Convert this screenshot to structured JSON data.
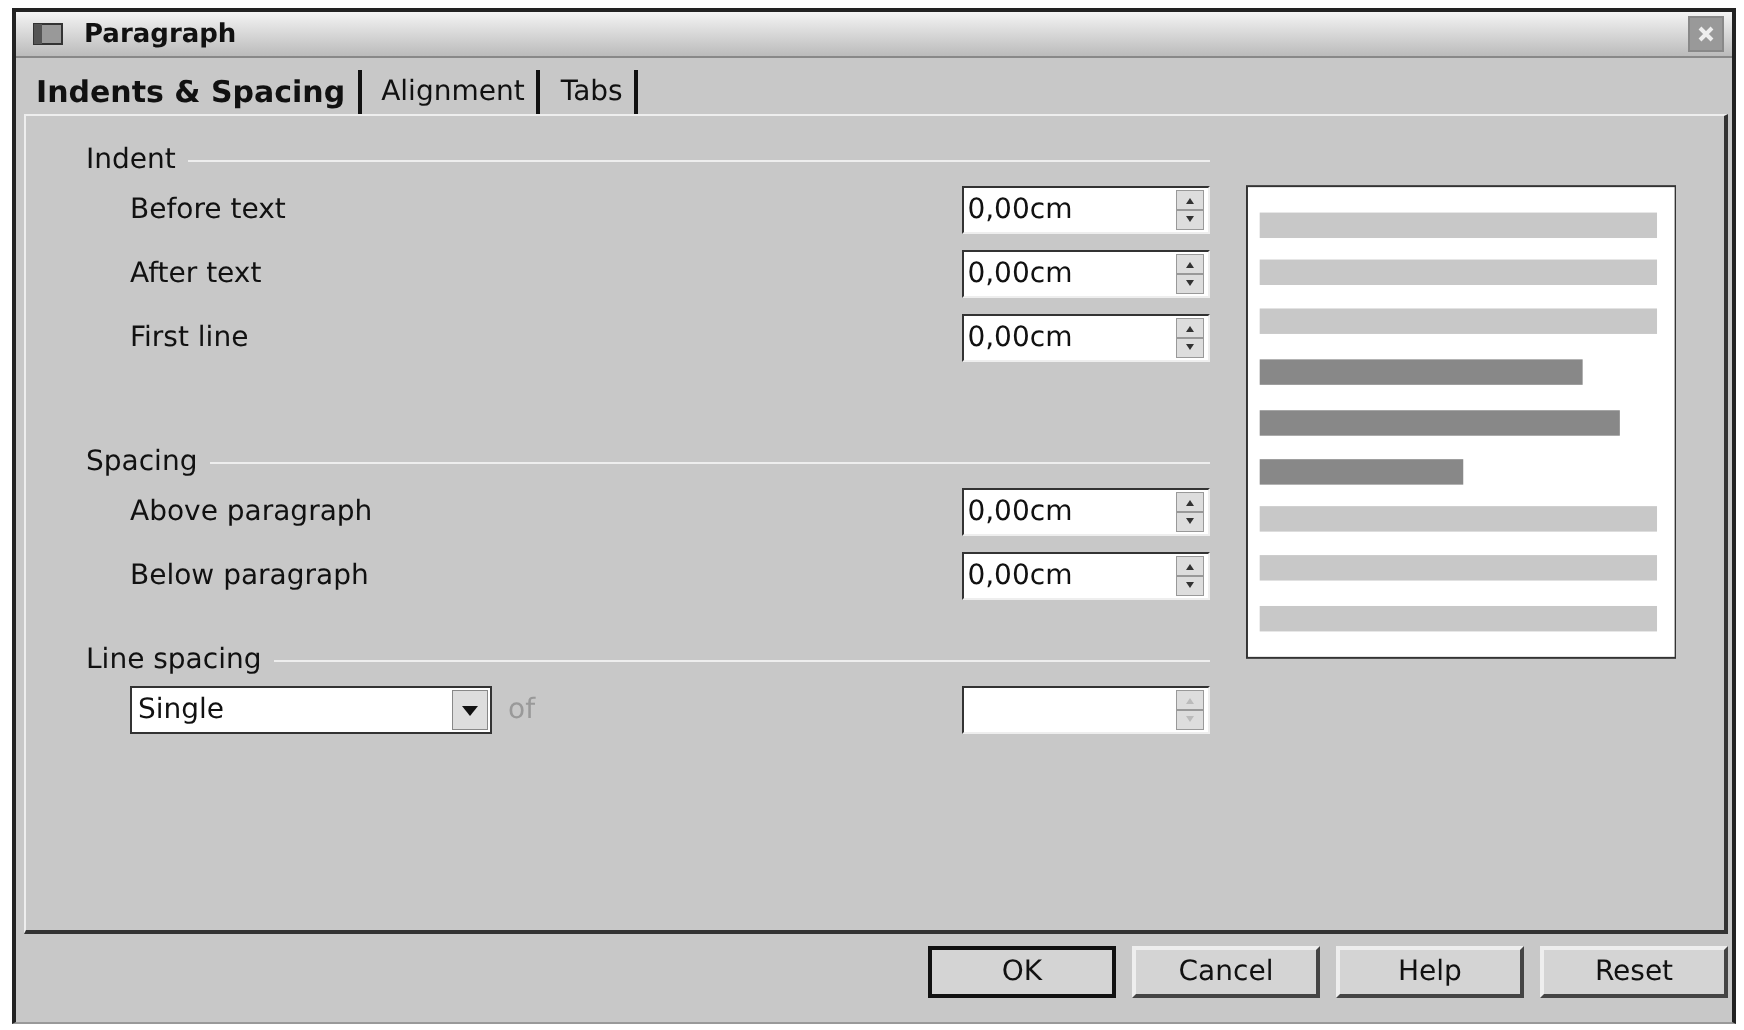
{
  "window": {
    "title": "Paragraph"
  },
  "tabs": [
    {
      "label": "Indents & Spacing",
      "selected": true
    },
    {
      "label": "Alignment",
      "selected": false
    },
    {
      "label": "Tabs",
      "selected": false
    }
  ],
  "groups": [
    {
      "title": "Indent",
      "rows": [
        {
          "label": "Before text",
          "value": "0,00cm"
        },
        {
          "label": "After text",
          "value": "0,00cm"
        },
        {
          "label": "First line",
          "value": "0,00cm"
        }
      ]
    },
    {
      "title": "Spacing",
      "rows": [
        {
          "label": "Above paragraph",
          "value": "0,00cm"
        },
        {
          "label": "Below paragraph",
          "value": "0,00cm"
        }
      ]
    }
  ],
  "line_spacing": {
    "title": "Line spacing",
    "dropdown": "Single",
    "of_label": "of",
    "of_disabled": true,
    "value_disabled": true
  },
  "buttons": [
    {
      "label": "OK",
      "default": true
    },
    {
      "label": "Cancel",
      "default": false
    },
    {
      "label": "Help",
      "default": false
    },
    {
      "label": "Reset",
      "default": false
    }
  ]
}
